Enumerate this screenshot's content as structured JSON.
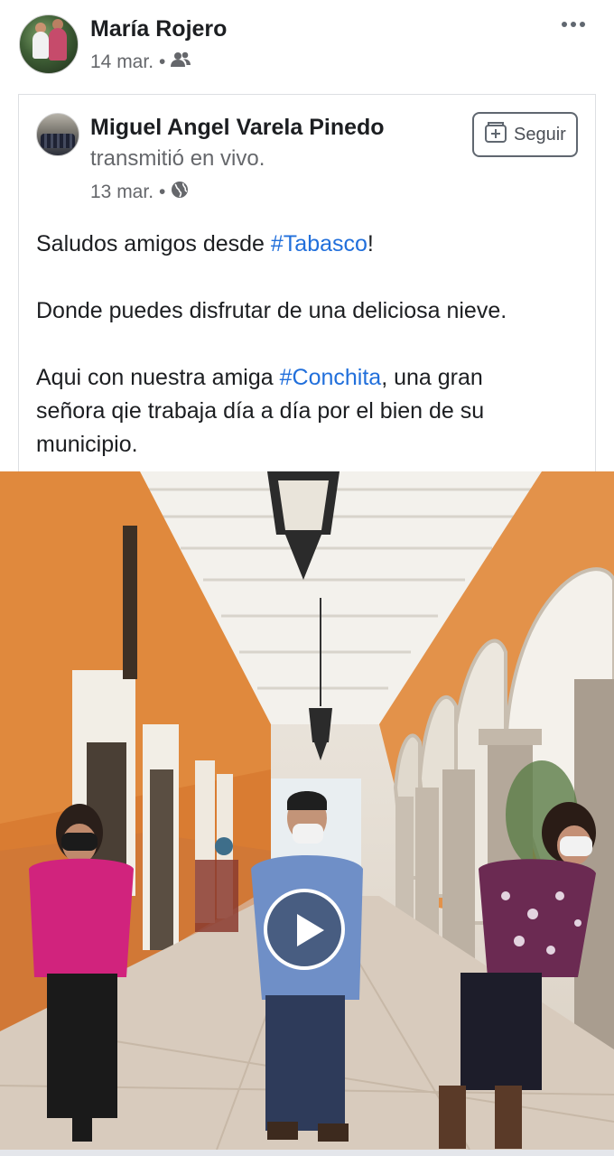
{
  "post": {
    "author": "María Rojero",
    "date": "14 mar.",
    "audience_icon": "friends-icon",
    "more_icon": "more-options-icon"
  },
  "shared": {
    "author": "Miguel Angel Varela Pinedo",
    "action": "transmitió en vivo.",
    "date": "13 mar.",
    "audience_icon": "globe-icon",
    "follow_label": "Seguir",
    "text": {
      "line1_prefix": "Saludos amigos desde ",
      "line1_tag": "#Tabasco",
      "line1_suffix": "!",
      "line2": "Donde puedes disfrutar de una deliciosa nieve.",
      "line3_prefix": "Aqui con nuestra amiga ",
      "line3_tag": "#Conchita",
      "line3_suffix": ", una gran",
      "line4": "señora qie trabaja día a día por el bien de su",
      "line5": "municipio."
    }
  },
  "video": {
    "play_icon": "play-icon"
  },
  "colors": {
    "hashtag": "#216fdb",
    "meta": "#65676b",
    "wall_orange": "#e08b3e"
  }
}
